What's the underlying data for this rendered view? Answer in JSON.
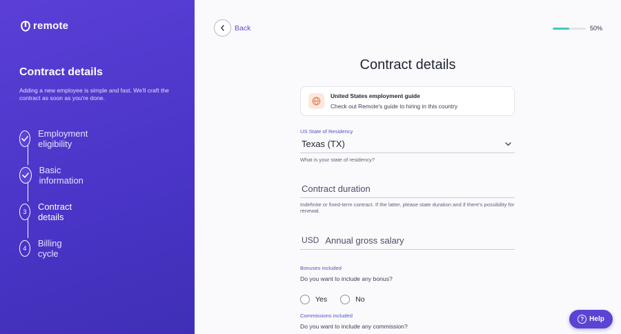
{
  "brand": {
    "logo_text": "remote",
    "logo_icon": "remote-logo-icon",
    "accent": "#4a35c8",
    "teal": "#44c6c0"
  },
  "sidebar": {
    "title": "Contract details",
    "description": "Adding a new employee is simple and fast. We'll craft the contract as soon as you're done.",
    "steps": [
      {
        "label": "Employment eligibility",
        "marker": "",
        "status": "done",
        "icon": "check-icon"
      },
      {
        "label": "Basic information",
        "marker": "",
        "status": "done",
        "icon": "check-icon"
      },
      {
        "label": "Contract details",
        "marker": "3",
        "status": "active"
      },
      {
        "label": "Billing cycle",
        "marker": "4",
        "status": "pending"
      }
    ]
  },
  "header": {
    "back_label": "Back",
    "progress_value": 0.5,
    "progress_text": "50%"
  },
  "form": {
    "title": "Contract details",
    "guide": {
      "title": "United States employment guide",
      "subtitle": "Check out Remote's guide to hiring in this country",
      "icon": "globe-icon"
    },
    "state": {
      "label": "US State of Residency",
      "value": "Texas (TX)",
      "help": "What is your state of residency?"
    },
    "duration": {
      "placeholder": "Contract duration",
      "help": "Indefinite or fixed-term contract. If the latter, please state duration and if there's possibility for renewal."
    },
    "salary": {
      "currency": "USD",
      "placeholder": "Annual gross salary"
    },
    "bonuses": {
      "label": "Bonuses included",
      "question": "Do you want to include any bonus?",
      "options": [
        "Yes",
        "No"
      ]
    },
    "commissions": {
      "label": "Commissions included",
      "question": "Do you want to include any commission?"
    }
  },
  "help_button": {
    "label": "Help",
    "icon_text": "?"
  }
}
